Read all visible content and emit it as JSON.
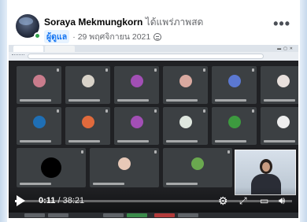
{
  "post": {
    "author_name": "Soraya Mekmungkorn",
    "action_text": "ได้แพร่ภาพสด",
    "role_badge": "ผู้ดูแล",
    "separator": "·",
    "date": "29 พฤศจิกายน 2021",
    "more_label": "•••"
  },
  "meeting": {
    "participants": [
      {
        "avatar_color": "#c97c8c"
      },
      {
        "avatar_color": "#d8d2c8"
      },
      {
        "avatar_color": "#a24fb5"
      },
      {
        "avatar_color": "#d9a9a0"
      },
      {
        "avatar_color": "#5b78d1"
      },
      {
        "avatar_color": "#e8e0dc"
      },
      {
        "avatar_color": "#1f6fb5"
      },
      {
        "avatar_color": "#e06a3c"
      },
      {
        "avatar_color": "#a24fb5"
      },
      {
        "avatar_color": "#dfe7df"
      },
      {
        "avatar_color": "#3d9a3f"
      },
      {
        "avatar_color": "#eeeeee"
      },
      {
        "avatar_color": "#000000"
      },
      {
        "avatar_color": "#e7c8b7"
      },
      {
        "avatar_color": "#6aa84f"
      }
    ]
  },
  "player": {
    "current_time": "0:11",
    "time_separator": " / ",
    "total_time": "38:21",
    "progress_fraction": 0.005,
    "icons": [
      "play-icon",
      "settings-gear-icon",
      "fullscreen-expand-icon",
      "captions-icon",
      "volume-icon"
    ]
  }
}
